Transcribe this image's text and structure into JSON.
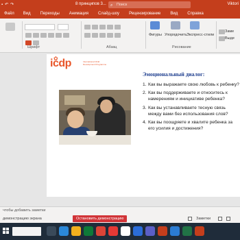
{
  "window": {
    "doc_title": "8 принципов 3...",
    "search_placeholder": "Поиск",
    "user": "Viktori"
  },
  "ribbon_tabs": [
    "Файл",
    "Вид",
    "Переходы",
    "Анимация",
    "Слайд-шоу",
    "Рецензирование",
    "Вид",
    "Справка"
  ],
  "ribbon_groups": {
    "font": "Шрифт",
    "paragraph": "Абзац",
    "drawing": "Рисование",
    "shapes": "Фигуры",
    "arrange": "Упорядочить",
    "quick_styles": "Экспресс-стили",
    "replace": "Заме",
    "select": "Выде"
  },
  "slide": {
    "logo_text": "icdp",
    "logo_sub": "International Child Development Programme",
    "title": "Эмоциональный диалог:",
    "questions": [
      "Как вы выражаете свою любовь к ребенку?",
      "Как вы поддерживаете и относитесь к намерениям и инициативе ребенка?",
      "Как вы устанавливаете тесную связь между вами без использования слов?",
      "Как вы поощряете и хвалите ребенка за его усилия и достижения?"
    ]
  },
  "notes_placeholder": "чтобы добавить заметки",
  "status": {
    "sharing_text": "демонстрацию экрана",
    "stop_sharing": "Остановить демонстрацию",
    "notes_button": "Заметки"
  },
  "colors": {
    "accent": "#c43e1c",
    "title_blue": "#1f3f8f",
    "logo_orange": "#e8562a",
    "taskbar": "#1f2c3a"
  }
}
